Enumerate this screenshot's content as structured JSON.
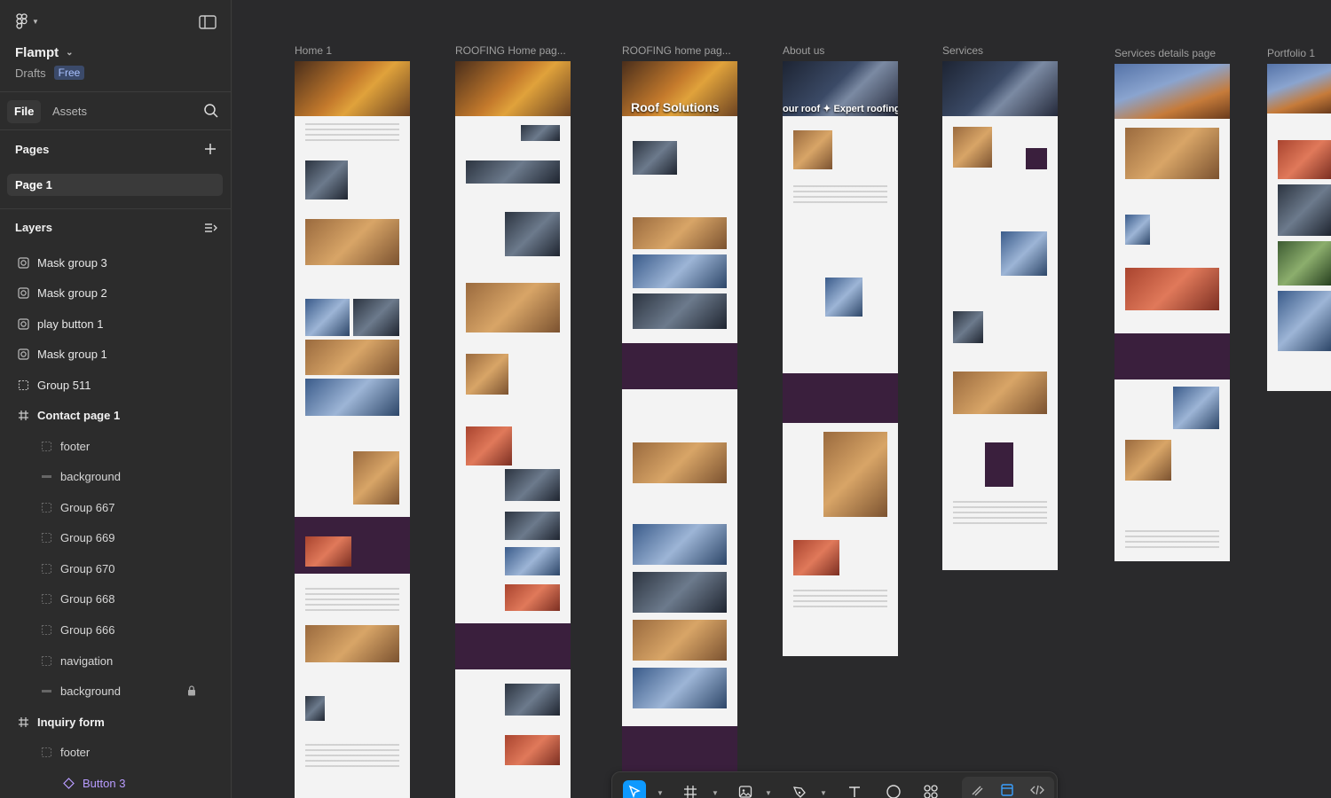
{
  "sidebar": {
    "project_name": "Flampt",
    "drafts": "Drafts",
    "plan_badge": "Free",
    "tabs": {
      "file": "File",
      "assets": "Assets"
    },
    "pages_header": "Pages",
    "current_page": "Page 1",
    "layers_header": "Layers",
    "layers": [
      {
        "label": "Mask group 3",
        "icon": "mask-icon"
      },
      {
        "label": "Mask group 2",
        "icon": "mask-icon"
      },
      {
        "label": "play button 1",
        "icon": "mask-icon"
      },
      {
        "label": "Mask group 1",
        "icon": "mask-icon"
      },
      {
        "label": "Group 511",
        "icon": "group-icon"
      },
      {
        "label": "Contact page 1",
        "icon": "frame-icon"
      },
      {
        "label": "footer",
        "icon": "group-icon"
      },
      {
        "label": "background",
        "icon": "rectangle-icon"
      },
      {
        "label": "Group 667",
        "icon": "group-icon"
      },
      {
        "label": "Group 669",
        "icon": "group-icon"
      },
      {
        "label": "Group 670",
        "icon": "group-icon"
      },
      {
        "label": "Group 668",
        "icon": "group-icon"
      },
      {
        "label": "Group 666",
        "icon": "group-icon"
      },
      {
        "label": "navigation",
        "icon": "group-icon"
      },
      {
        "label": "background",
        "icon": "rectangle-icon"
      },
      {
        "label": "Inquiry form",
        "icon": "frame-icon"
      },
      {
        "label": "footer",
        "icon": "group-icon"
      },
      {
        "label": "Button 3",
        "icon": "component-icon"
      }
    ]
  },
  "canvas": {
    "frames": [
      {
        "label": "Home 1"
      },
      {
        "label": "ROOFING Home pag..."
      },
      {
        "label": "ROOFING home pag...",
        "hero_text": "Roof Solutions"
      },
      {
        "label": "About us",
        "hero_text": "our roof  ✦ Expert roofing"
      },
      {
        "label": "Services"
      },
      {
        "label": "Services details page"
      },
      {
        "label": "Portfolio 1"
      }
    ]
  },
  "toolbar": {
    "tools": [
      "move-icon",
      "frame-icon",
      "image-icon",
      "pen-icon",
      "text-icon",
      "ellipse-icon",
      "components-icon"
    ],
    "right_tools": [
      "draw-icon",
      "layout-icon",
      "code-icon"
    ],
    "colors": {
      "active": "#0d99ff"
    }
  }
}
